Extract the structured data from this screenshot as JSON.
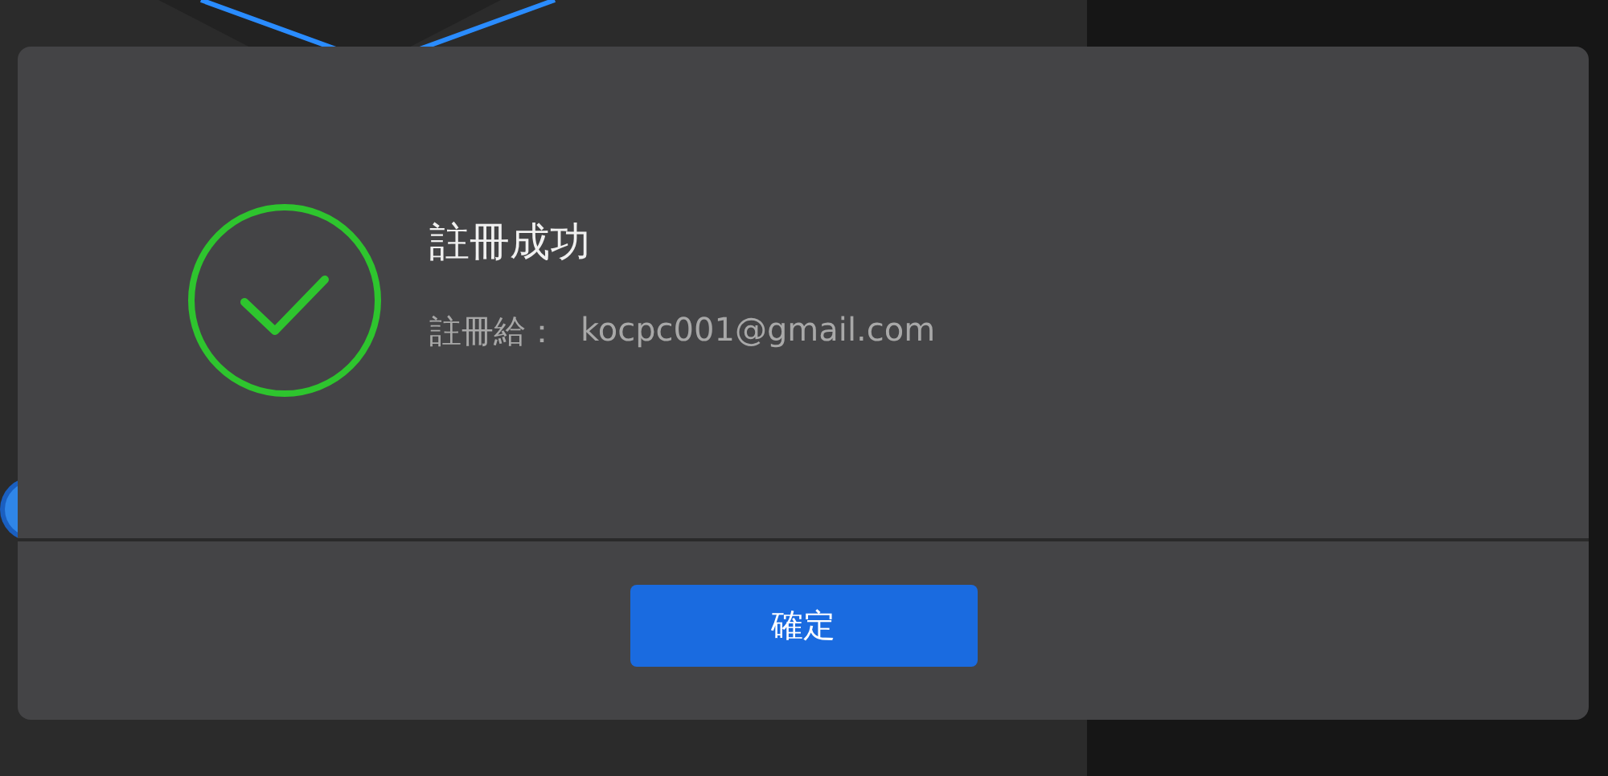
{
  "dialog": {
    "title": "註冊成功",
    "registered_to_label": "註冊給：",
    "registered_to_value": "kocpc001@gmail.com",
    "buttons": [
      "確定"
    ]
  }
}
